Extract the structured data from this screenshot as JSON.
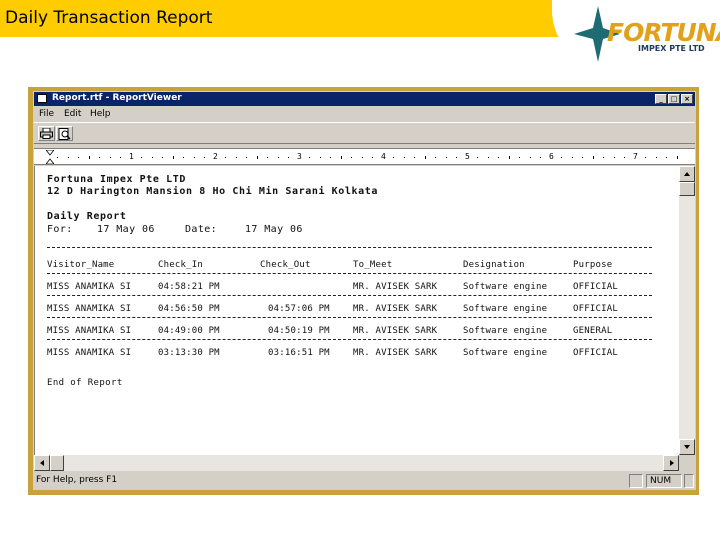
{
  "slide": {
    "title": "Daily Transaction Report",
    "logo_name": "FORTUNA",
    "logo_subtitle": "IMPEX PTE LTD"
  },
  "window": {
    "title": "Report.rtf - ReportViewer",
    "menu": [
      "File",
      "Edit",
      "Help"
    ],
    "ruler_numbers": [
      "1",
      "2",
      "3",
      "4",
      "5",
      "6",
      "7"
    ],
    "status_text": "For Help, press F1",
    "status_num": "NUM"
  },
  "report": {
    "company": "Fortuna Impex Pte LTD",
    "address": "12 D Harington Mansion 8 Ho Chi Min Sarani Kolkata",
    "heading": "Daily Report",
    "for_label": "For:",
    "for_value": "17 May 06",
    "date_label": "Date:",
    "date_value": "17 May 06",
    "columns": [
      "Visitor_Name",
      "Check_In",
      "Check_Out",
      "To_Meet",
      "Designation",
      "Purpose"
    ],
    "rows": [
      [
        "MISS ANAMIKA SI",
        "04:58:21 PM",
        "",
        "MR. AVISEK SARK",
        "Software engine",
        "OFFICIAL"
      ],
      [
        "MISS ANAMIKA SI",
        "04:56:50 PM",
        "04:57:06 PM",
        "MR. AVISEK SARK",
        "Software engine",
        "OFFICIAL"
      ],
      [
        "MISS ANAMIKA SI",
        "04:49:00 PM",
        "04:50:19 PM",
        "MR. AVISEK SARK",
        "Software engine",
        "GENERAL"
      ],
      [
        "MISS ANAMIKA SI",
        "03:13:30 PM",
        "03:16:51 PM",
        "MR. AVISEK SARK",
        "Software engine",
        "OFFICIAL"
      ]
    ],
    "footer": "End of Report"
  },
  "colors": {
    "header_bar": "#ffcc00",
    "frame": "#c8a23a",
    "titlebar": "#0a246a",
    "logo_orange": "#e2a11a",
    "logo_teal": "#1f6b74"
  },
  "icons": [
    "app-icon",
    "minimize-icon",
    "maximize-icon",
    "close-icon",
    "print-icon",
    "preview-icon",
    "tab-marker-icon",
    "arrow-up-icon",
    "arrow-down-icon",
    "arrow-left-icon",
    "arrow-right-icon",
    "logo-star-icon"
  ]
}
